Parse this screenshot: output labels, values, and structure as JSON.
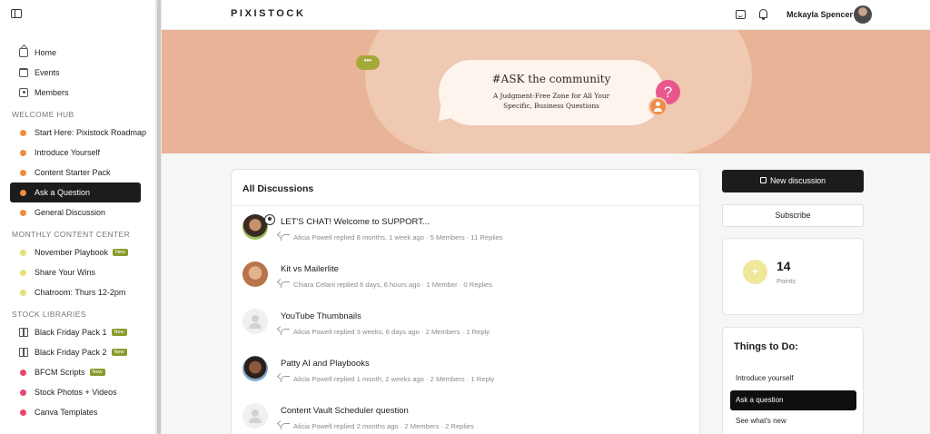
{
  "sidebar": {
    "items": [
      {
        "label": "Home",
        "icon": "home-icon"
      },
      {
        "label": "Events",
        "icon": "calendar-icon"
      },
      {
        "label": "Members",
        "icon": "members-icon"
      }
    ],
    "sections": [
      {
        "title": "WELCOME HUB",
        "items": [
          {
            "label": "Start Here: Pixistock Roadmap",
            "color": "#f08c3e"
          },
          {
            "label": "Introduce Yourself",
            "color": "#f08c3e"
          },
          {
            "label": "Content Starter Pack",
            "color": "#f08c3e"
          },
          {
            "label": "Ask a Question",
            "color": "#f08c3e",
            "active": true
          },
          {
            "label": "General Discussion",
            "color": "#f08c3e"
          }
        ]
      },
      {
        "title": "MONTHLY CONTENT CENTER",
        "items": [
          {
            "label": "November Playbook",
            "color": "#e3e07a",
            "badge": "New"
          },
          {
            "label": "Share Your Wins",
            "color": "#e3e07a"
          },
          {
            "label": "Chatroom: Thurs 12-2pm",
            "color": "#e3e07a"
          }
        ]
      },
      {
        "title": "STOCK LIBRARIES",
        "items": [
          {
            "label": "Black Friday Pack 1",
            "icon": "gift-icon",
            "badge": "New"
          },
          {
            "label": "Black Friday Pack 2",
            "icon": "gift-icon",
            "badge": "New"
          },
          {
            "label": "BFCM Scripts",
            "color": "#e8476f",
            "badge": "New"
          },
          {
            "label": "Stock Photos + Videos",
            "color": "#e8476f"
          },
          {
            "label": "Canva Templates",
            "color": "#e8476f"
          }
        ]
      }
    ]
  },
  "header": {
    "logo": "PIXISTOCK",
    "username": "Mckayla Spencer"
  },
  "banner": {
    "title": "#ASK the community",
    "subtitle_line1": "A Judgment-Free Zone for All Your",
    "subtitle_line2": "Specific, Business Questions",
    "dots": "•••",
    "question_mark": "?"
  },
  "discussions": {
    "heading": "All Discussions",
    "rows": [
      {
        "title": "LET'S CHAT! Welcome to SUPPORT...",
        "meta": "Alicia Powell replied 8 months, 1 week ago  ·  5 Members · 11 Replies",
        "avatar": "woman1",
        "pinned": true
      },
      {
        "title": "Kit vs Mailerlite",
        "meta": "Chiara Celani replied 6 days, 6 hours ago  ·  1 Member · 0 Replies",
        "avatar": "woman2"
      },
      {
        "title": "YouTube Thumbnails",
        "meta": "Alicia Powell replied 3 weeks, 6 days ago  ·  2 Members · 1 Reply",
        "avatar": "blank"
      },
      {
        "title": "Patty AI and Playbooks",
        "meta": "Alicia Powell replied 1 month, 2 weeks ago  ·  2 Members · 1 Reply",
        "avatar": "woman3"
      },
      {
        "title": "Content Vault Scheduler question",
        "meta": "Alicia Powell replied 2 months ago  ·  2 Members · 2 Replies",
        "avatar": "blank"
      }
    ]
  },
  "actions": {
    "new_discussion": "New discussion",
    "subscribe": "Subscribe"
  },
  "points": {
    "value": "14",
    "label": "Points",
    "plus": "+"
  },
  "todo": {
    "title": "Things to Do:",
    "items": [
      {
        "label": "Introduce yourself"
      },
      {
        "label": "Ask a question",
        "active": true
      },
      {
        "label": "See what's new"
      }
    ]
  }
}
